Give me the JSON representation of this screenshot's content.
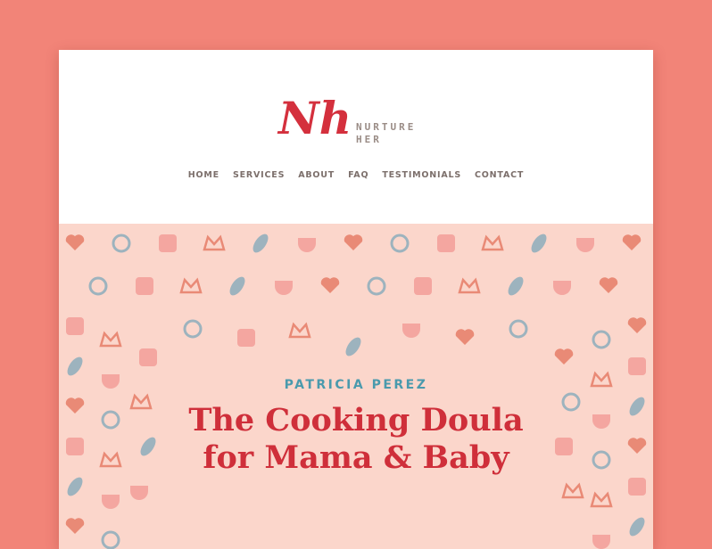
{
  "brand": {
    "monogram": "Nh",
    "name_line1": "NURTURE",
    "name_line2": "HER",
    "colors": {
      "monogram": "#d4303d",
      "name": "#9a8c86"
    }
  },
  "nav": {
    "items": [
      {
        "label": "HOME"
      },
      {
        "label": "SERVICES"
      },
      {
        "label": "ABOUT"
      },
      {
        "label": "FAQ"
      },
      {
        "label": "TESTIMONIALS"
      },
      {
        "label": "CONTACT"
      }
    ]
  },
  "hero": {
    "subtitle": "PATRICIA PEREZ",
    "headline_line1": "The Cooking Doula",
    "headline_line2": "for Mama & Baby",
    "colors": {
      "background": "#fbd6cb",
      "subtitle": "#4a9aad",
      "headline": "#cf2f3a",
      "pattern_coral": "#e98a76",
      "pattern_blue": "#9db3be",
      "pattern_pink": "#f4a6a0"
    },
    "pattern_icons": [
      "onesie-icon",
      "baby-mobile-icon",
      "crown-icon",
      "rattle-icon",
      "cooking-pot-icon",
      "bib-icon",
      "baby-bottle-icon",
      "utensils-icon",
      "heart-icon",
      "pacifier-icon",
      "flower-icon",
      "diaper-roll-icon"
    ]
  },
  "page": {
    "background": "#f28478"
  }
}
